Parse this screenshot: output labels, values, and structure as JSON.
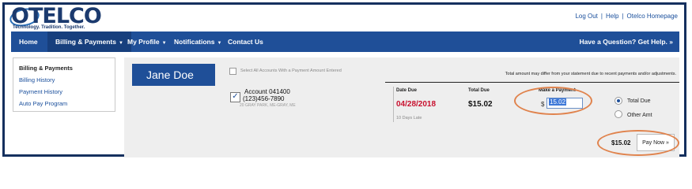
{
  "brand": {
    "logo_text": "OTELCO",
    "tagline": "Technology. Tradition. Together."
  },
  "top_links": [
    "Log Out",
    "Help",
    "Otelco Homepage"
  ],
  "top_links_separator": "|",
  "nav": {
    "items": [
      {
        "label": "Home"
      },
      {
        "label": "Billing & Payments",
        "caret": "▼"
      },
      {
        "label": "My Profile",
        "caret": "▼"
      },
      {
        "label": "Notifications",
        "caret": "▼"
      },
      {
        "label": "Contact Us"
      }
    ],
    "help": "Have a Question? Get Help. »"
  },
  "sidebar": {
    "heading": "Billing & Payments",
    "links": [
      "Billing History",
      "Payment History",
      "Auto Pay Program"
    ]
  },
  "customer_name": "Jane Doe",
  "select_all_label": "Select All Accounts With a Payment Amount Entered",
  "notice": "Total amount may differ from your statement due to recent payments and/or adjustments.",
  "columns": {
    "date_due": "Date Due",
    "total_due": "Total Due",
    "make_payment": "Make a Payment"
  },
  "account": {
    "checked": true,
    "check_glyph": "✓",
    "name": "Account 041400",
    "phone": "(123)456-7890",
    "address": "20 GRAY PARK, ME-GRAY, ME",
    "date_due": "04/28/2018",
    "late_note": "10 Days Late",
    "total_due": "$15.02",
    "currency_symbol": "$",
    "payment_value": "15.02"
  },
  "payment_options": [
    "Total Due",
    "Other Amt"
  ],
  "selected_option": "Total Due",
  "summary_total": "$15.02",
  "pay_button": "Pay Now »",
  "colors": {
    "nav": "#1f4f98",
    "accent_red": "#c8102e",
    "highlight_oval": "#e0834d",
    "frame": "#15305e"
  }
}
